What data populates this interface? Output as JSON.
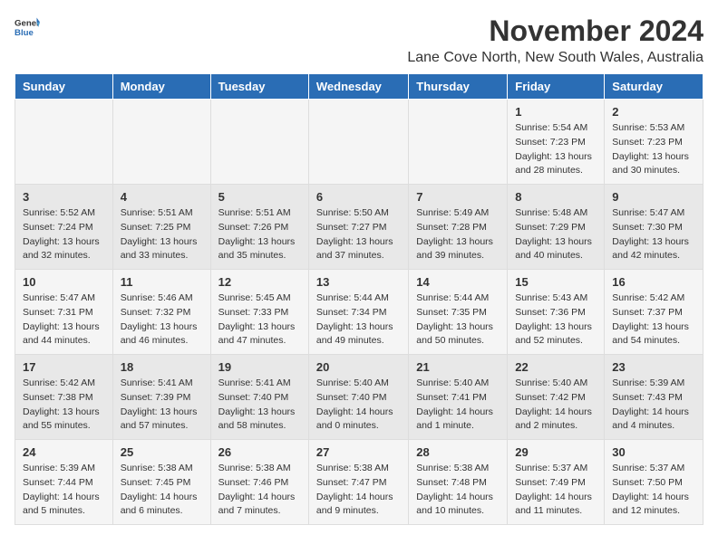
{
  "logo": {
    "general": "General",
    "blue": "Blue"
  },
  "header": {
    "month": "November 2024",
    "location": "Lane Cove North, New South Wales, Australia"
  },
  "weekdays": [
    "Sunday",
    "Monday",
    "Tuesday",
    "Wednesday",
    "Thursday",
    "Friday",
    "Saturday"
  ],
  "weeks": [
    [
      {
        "day": "",
        "info": ""
      },
      {
        "day": "",
        "info": ""
      },
      {
        "day": "",
        "info": ""
      },
      {
        "day": "",
        "info": ""
      },
      {
        "day": "",
        "info": ""
      },
      {
        "day": "1",
        "info": "Sunrise: 5:54 AM\nSunset: 7:23 PM\nDaylight: 13 hours\nand 28 minutes."
      },
      {
        "day": "2",
        "info": "Sunrise: 5:53 AM\nSunset: 7:23 PM\nDaylight: 13 hours\nand 30 minutes."
      }
    ],
    [
      {
        "day": "3",
        "info": "Sunrise: 5:52 AM\nSunset: 7:24 PM\nDaylight: 13 hours\nand 32 minutes."
      },
      {
        "day": "4",
        "info": "Sunrise: 5:51 AM\nSunset: 7:25 PM\nDaylight: 13 hours\nand 33 minutes."
      },
      {
        "day": "5",
        "info": "Sunrise: 5:51 AM\nSunset: 7:26 PM\nDaylight: 13 hours\nand 35 minutes."
      },
      {
        "day": "6",
        "info": "Sunrise: 5:50 AM\nSunset: 7:27 PM\nDaylight: 13 hours\nand 37 minutes."
      },
      {
        "day": "7",
        "info": "Sunrise: 5:49 AM\nSunset: 7:28 PM\nDaylight: 13 hours\nand 39 minutes."
      },
      {
        "day": "8",
        "info": "Sunrise: 5:48 AM\nSunset: 7:29 PM\nDaylight: 13 hours\nand 40 minutes."
      },
      {
        "day": "9",
        "info": "Sunrise: 5:47 AM\nSunset: 7:30 PM\nDaylight: 13 hours\nand 42 minutes."
      }
    ],
    [
      {
        "day": "10",
        "info": "Sunrise: 5:47 AM\nSunset: 7:31 PM\nDaylight: 13 hours\nand 44 minutes."
      },
      {
        "day": "11",
        "info": "Sunrise: 5:46 AM\nSunset: 7:32 PM\nDaylight: 13 hours\nand 46 minutes."
      },
      {
        "day": "12",
        "info": "Sunrise: 5:45 AM\nSunset: 7:33 PM\nDaylight: 13 hours\nand 47 minutes."
      },
      {
        "day": "13",
        "info": "Sunrise: 5:44 AM\nSunset: 7:34 PM\nDaylight: 13 hours\nand 49 minutes."
      },
      {
        "day": "14",
        "info": "Sunrise: 5:44 AM\nSunset: 7:35 PM\nDaylight: 13 hours\nand 50 minutes."
      },
      {
        "day": "15",
        "info": "Sunrise: 5:43 AM\nSunset: 7:36 PM\nDaylight: 13 hours\nand 52 minutes."
      },
      {
        "day": "16",
        "info": "Sunrise: 5:42 AM\nSunset: 7:37 PM\nDaylight: 13 hours\nand 54 minutes."
      }
    ],
    [
      {
        "day": "17",
        "info": "Sunrise: 5:42 AM\nSunset: 7:38 PM\nDaylight: 13 hours\nand 55 minutes."
      },
      {
        "day": "18",
        "info": "Sunrise: 5:41 AM\nSunset: 7:39 PM\nDaylight: 13 hours\nand 57 minutes."
      },
      {
        "day": "19",
        "info": "Sunrise: 5:41 AM\nSunset: 7:40 PM\nDaylight: 13 hours\nand 58 minutes."
      },
      {
        "day": "20",
        "info": "Sunrise: 5:40 AM\nSunset: 7:40 PM\nDaylight: 14 hours\nand 0 minutes."
      },
      {
        "day": "21",
        "info": "Sunrise: 5:40 AM\nSunset: 7:41 PM\nDaylight: 14 hours\nand 1 minute."
      },
      {
        "day": "22",
        "info": "Sunrise: 5:40 AM\nSunset: 7:42 PM\nDaylight: 14 hours\nand 2 minutes."
      },
      {
        "day": "23",
        "info": "Sunrise: 5:39 AM\nSunset: 7:43 PM\nDaylight: 14 hours\nand 4 minutes."
      }
    ],
    [
      {
        "day": "24",
        "info": "Sunrise: 5:39 AM\nSunset: 7:44 PM\nDaylight: 14 hours\nand 5 minutes."
      },
      {
        "day": "25",
        "info": "Sunrise: 5:38 AM\nSunset: 7:45 PM\nDaylight: 14 hours\nand 6 minutes."
      },
      {
        "day": "26",
        "info": "Sunrise: 5:38 AM\nSunset: 7:46 PM\nDaylight: 14 hours\nand 7 minutes."
      },
      {
        "day": "27",
        "info": "Sunrise: 5:38 AM\nSunset: 7:47 PM\nDaylight: 14 hours\nand 9 minutes."
      },
      {
        "day": "28",
        "info": "Sunrise: 5:38 AM\nSunset: 7:48 PM\nDaylight: 14 hours\nand 10 minutes."
      },
      {
        "day": "29",
        "info": "Sunrise: 5:37 AM\nSunset: 7:49 PM\nDaylight: 14 hours\nand 11 minutes."
      },
      {
        "day": "30",
        "info": "Sunrise: 5:37 AM\nSunset: 7:50 PM\nDaylight: 14 hours\nand 12 minutes."
      }
    ]
  ]
}
